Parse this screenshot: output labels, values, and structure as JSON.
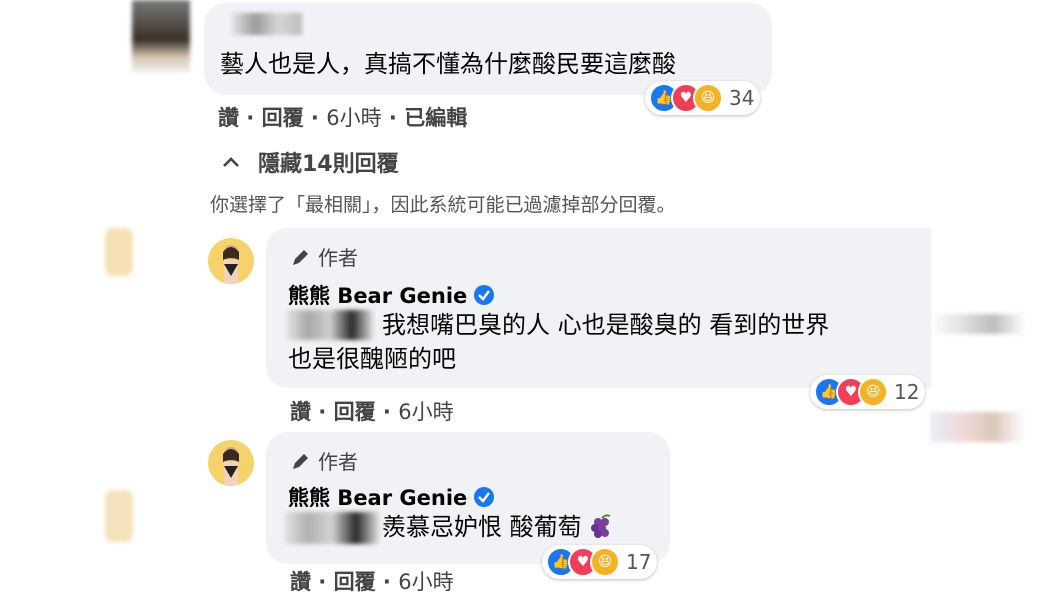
{
  "comment": {
    "text": "藝人也是人，真搞不懂為什麼酸民要這麼酸",
    "actions": [
      "讚",
      "回覆",
      "6小時",
      "已編輯"
    ],
    "reaction_count": "34"
  },
  "hide_replies": {
    "label": "隱藏14則回覆"
  },
  "filter_notice": "你選擇了「最相關」，因此系統可能已過濾掉部分回覆。",
  "replies": [
    {
      "author_tag": "作者",
      "name": "熊熊 Bear Genie",
      "text_line1": "我想嘴巴臭的人 心也是酸臭的 看到的世界",
      "text_line2": "也是很醜陋的吧",
      "actions": [
        "讚",
        "回覆",
        "6小時"
      ],
      "reaction_count": "12"
    },
    {
      "author_tag": "作者",
      "name": "熊熊 Bear Genie",
      "text": "羨慕忌妒恨 酸葡萄",
      "actions": [
        "讚",
        "回覆",
        "6小時"
      ],
      "reaction_count": "17"
    }
  ],
  "icons": [
    "pencil-icon",
    "verified-badge-icon",
    "chevron-up-icon",
    "grape-emoji-icon",
    "like-reaction-icon",
    "love-reaction-icon",
    "haha-reaction-icon"
  ],
  "colors": {
    "bubble": "#f0f2f5",
    "like": "#1877f2",
    "love": "#f33e58",
    "haha": "#f7b125"
  }
}
